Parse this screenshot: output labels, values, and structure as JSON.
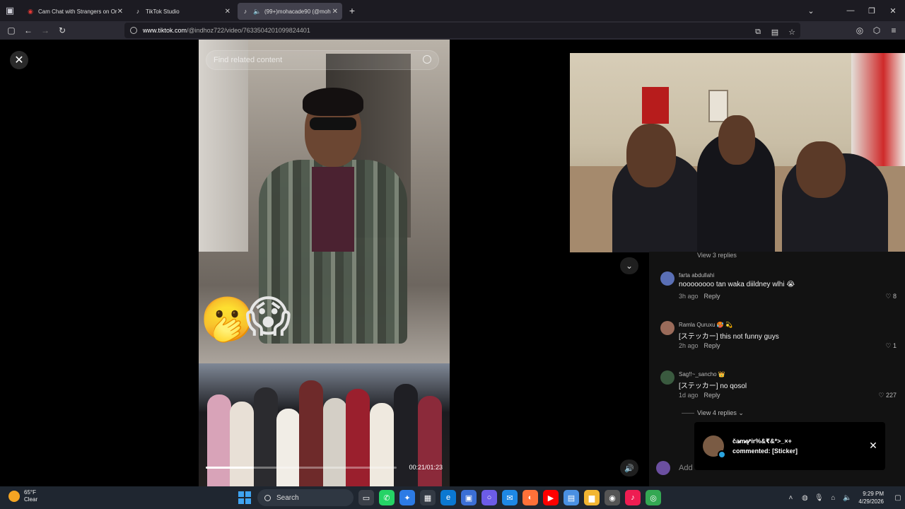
{
  "browser": {
    "tabs": [
      {
        "title": "Cam Chat with Strangers on Or",
        "active": false
      },
      {
        "title": "TikTok Studio",
        "active": false
      },
      {
        "title": "(99+)mohacade90 (@moh",
        "active": true
      }
    ],
    "url_host": "www.tiktok.com",
    "url_path": "/@indhoz722/video/7633504201099824401"
  },
  "video": {
    "search_placeholder": "Find related content",
    "time": "00:21/01:23",
    "progress": 0.253
  },
  "comments": {
    "view_replies_top": "View 3 replies",
    "items": [
      {
        "user": "farta abdullahi",
        "text": "noooooooo tan waka diildney wlhi 😭",
        "time": "3h ago",
        "reply": "Reply",
        "likes": "8",
        "avatar_color": "#5a6fb5"
      },
      {
        "user": "Ramla Quruxu 🥵 💫",
        "text": "[ステッカー] this not funny guys",
        "time": "2h ago",
        "reply": "Reply",
        "likes": "1",
        "avatar_color": "#9a6b5a"
      },
      {
        "user": "Sag!!~_sancho 👑",
        "text": "[ステッカー] no qosol",
        "time": "1d ago",
        "reply": "Reply",
        "likes": "227",
        "avatar_color": "#3a5a3f"
      }
    ],
    "view_replies": "View 4 replies",
    "add_placeholder": "Add"
  },
  "toast": {
    "line1": "ča̷̷m̷̷ą̷̷ªir%&₹&*>_×+",
    "line2": "commented: [Sticker]"
  },
  "taskbar": {
    "temp": "65°F",
    "condition": "Clear",
    "search": "Search",
    "time": "9:29 PM",
    "date": "4/29/2026"
  }
}
